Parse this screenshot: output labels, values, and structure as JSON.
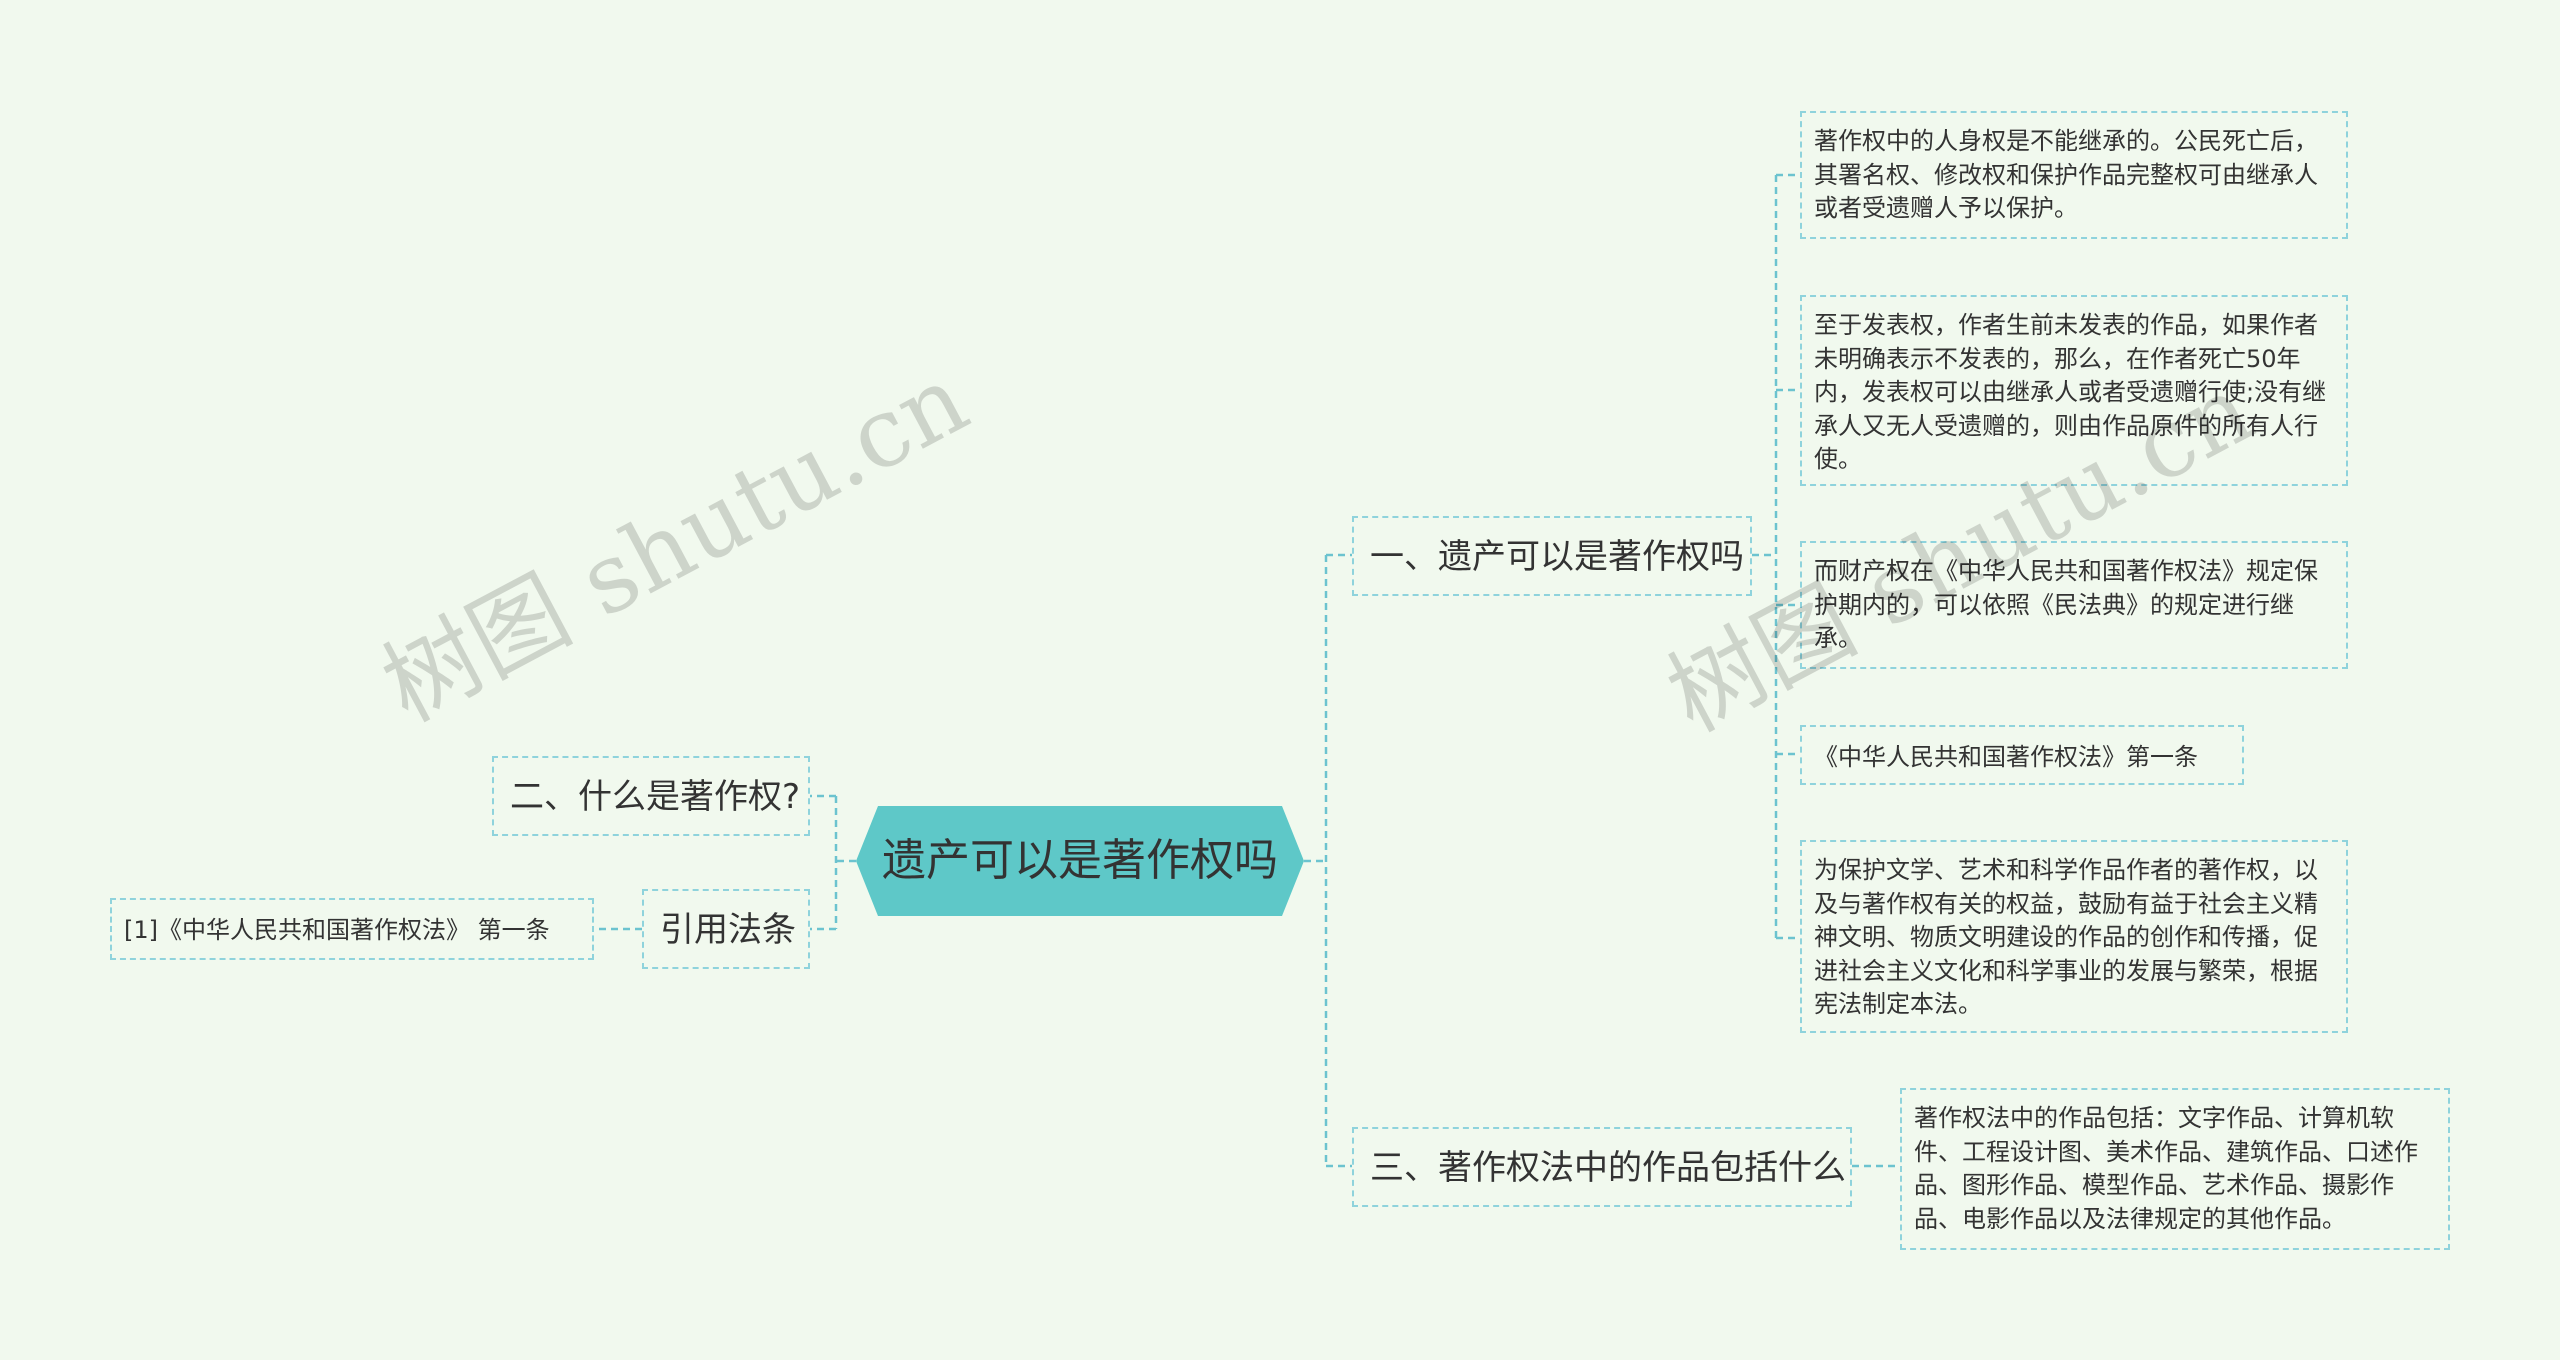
{
  "root": {
    "label": "遗产可以是著作权吗"
  },
  "branches": [
    {
      "label": "一、遗产可以是著作权吗",
      "children": [
        "著作权中的人身权是不能继承的。公民死亡后，其署名权、修改权和保护作品完整权可由继承人或者受遗赠人予以保护。",
        "至于发表权，作者生前未发表的作品，如果作者未明确表示不发表的，那么，在作者死亡50年内，发表权可以由继承人或者受遗赠行使;没有继承人又无人受遗赠的，则由作品原件的所有人行使。",
        "而财产权在《中华人民共和国著作权法》规定保护期内的，可以依照《民法典》的规定进行继承。",
        "《中华人民共和国著作权法》第一条",
        "为保护文学、艺术和科学作品作者的著作权，以及与著作权有关的权益，鼓励有益于社会主义精神文明、物质文明建设的作品的创作和传播，促进社会主义文化和科学事业的发展与繁荣，根据宪法制定本法。"
      ]
    },
    {
      "label": "三、著作权法中的作品包括什么",
      "children": [
        "著作权法中的作品包括：文字作品、计算机软件、工程设计图、美术作品、建筑作品、口述作品、图形作品、模型作品、艺术作品、摄影作品、电影作品以及法律规定的其他作品。"
      ]
    },
    {
      "label": "二、什么是著作权?",
      "children": []
    },
    {
      "label": "引用法条",
      "children": [
        "[1]《中华人民共和国著作权法》 第一条"
      ]
    }
  ],
  "watermark": "树图 shutu.cn",
  "colors": {
    "background": "#f1f9ee",
    "root_fill": "#5ec8c8",
    "connector": "#6cc3cf",
    "node_border": "#8fd3dc"
  }
}
